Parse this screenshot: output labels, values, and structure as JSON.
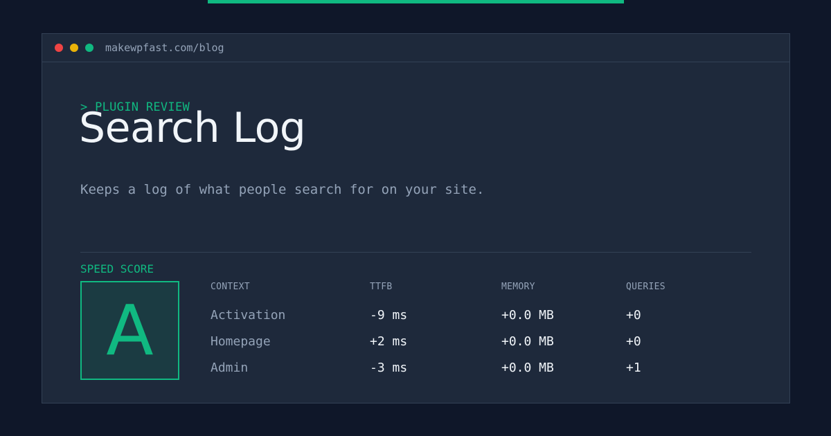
{
  "browser": {
    "url": "makewpfast.com/blog"
  },
  "post": {
    "kicker": "> PLUGIN REVIEW",
    "title": "Search Log",
    "description": "Keeps a log of what people search for on your site."
  },
  "score": {
    "label": "SPEED SCORE",
    "grade": "A"
  },
  "table": {
    "headers": [
      "CONTEXT",
      "TTFB",
      "MEMORY",
      "QUERIES"
    ],
    "rows": [
      [
        "Activation",
        "-9 ms",
        "+0.0 MB",
        "+0"
      ],
      [
        "Homepage",
        "+2 ms",
        "+0.0 MB",
        "+0"
      ],
      [
        "Admin",
        "-3 ms",
        "+0.0 MB",
        "+1"
      ]
    ]
  },
  "colors": {
    "background": "#0f1729",
    "panel": "#1e293b",
    "accent": "#10b981",
    "dot_red": "#ef4444",
    "dot_yellow": "#eab308",
    "dot_green": "#10b981"
  }
}
